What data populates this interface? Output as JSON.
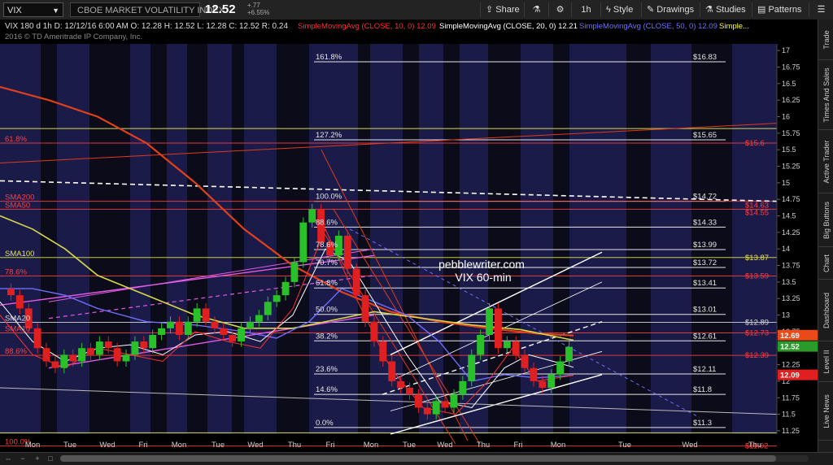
{
  "header": {
    "symbol": "VIX",
    "name": "CBOE MARKET VOLATILITY INDEX",
    "last": "12.52",
    "change": "+.77",
    "change_pct": "+6.55%",
    "share": "Share",
    "timeframe": "1h",
    "style": "Style",
    "drawings": "Drawings",
    "studies": "Studies",
    "patterns": "Patterns"
  },
  "sidebar": {
    "tabs": [
      "Trade",
      "Times And Sales",
      "Active Trader",
      "Big Buttons",
      "Chart",
      "Dashboard",
      "Level II",
      "Live News"
    ]
  },
  "chart_data": {
    "type": "candlestick",
    "ohlc_line": "VIX 180 d 1h  D: 12/12/16 6:00 AM  O: 12.28  H: 12.52  L: 12.28  C: 12.52  R: 0.24",
    "studies": [
      {
        "label": "SimpleMovingAvg (CLOSE, 10, 0)",
        "value": "12.09",
        "color": "#ff3030"
      },
      {
        "label": "SimpleMovingAvg (CLOSE, 20, 0)",
        "value": "12.21",
        "color": "#ffffff"
      },
      {
        "label": "SimpleMovingAvg (CLOSE, 50, 0)",
        "value": "12.09",
        "color": "#6f6fff"
      },
      {
        "label": "Simple...",
        "value": "",
        "color": "#ffff00"
      }
    ],
    "copyright": "2016 © TD Ameritrade IP Company, Inc.",
    "watermark": [
      "pebblewriter.com",
      "VIX 60-min"
    ],
    "ylim": [
      11.2,
      17.1
    ],
    "y_ticks": [
      "17",
      "16.75",
      "16.5",
      "16.25",
      "16",
      "15.75",
      "15.5",
      "15.25",
      "15",
      "14.75",
      "14.5",
      "14.25",
      "14",
      "13.75",
      "13.5",
      "13.25",
      "13",
      "12.75",
      "12.5",
      "12.25",
      "12",
      "11.75",
      "11.5",
      "11.25"
    ],
    "x_ticks": [
      "Mon",
      "Tue",
      "Wed",
      "Fri",
      "Mon",
      "Tue",
      "Wed",
      "Thu",
      "Fri",
      "Mon",
      "Tue",
      "Wed",
      "Thu",
      "Fri",
      "Mon",
      "Tue",
      "Wed",
      "Thu"
    ],
    "fib_levels": [
      {
        "label": "161.8%",
        "value": "$16.83",
        "y": 16.83
      },
      {
        "label": "127.2%",
        "value": "$15.65",
        "y": 15.65
      },
      {
        "label": "100.0%",
        "value": "$14.72",
        "y": 14.72
      },
      {
        "label": "88.6%",
        "value": "$14.33",
        "y": 14.33
      },
      {
        "label": "78.6%",
        "value": "$13.99",
        "y": 13.99
      },
      {
        "label": "70.7%",
        "value": "$13.72",
        "y": 13.72
      },
      {
        "label": "61.8%",
        "value": "$13.41",
        "y": 13.41
      },
      {
        "label": "50.0%",
        "value": "$13.01",
        "y": 13.01
      },
      {
        "label": "38.2%",
        "value": "$12.61",
        "y": 12.61
      },
      {
        "label": "23.6%",
        "value": "$12.11",
        "y": 12.11
      },
      {
        "label": "14.6%",
        "value": "$11.8",
        "y": 11.8
      },
      {
        "label": "0.0%",
        "value": "$11.3",
        "y": 11.3
      }
    ],
    "left_labels": [
      {
        "text": "61.8%",
        "y": 15.6,
        "color": "#ff4040"
      },
      {
        "text": "SMA200",
        "y": 14.72,
        "color": "#ff4040"
      },
      {
        "text": "SMA50",
        "y": 14.6,
        "color": "#ff4040"
      },
      {
        "text": "SMA100",
        "y": 13.87,
        "color": "#e8e84a"
      },
      {
        "text": "78.6%",
        "y": 13.59,
        "color": "#ff4040"
      },
      {
        "text": "SMA20",
        "y": 12.89,
        "color": "#dddddd"
      },
      {
        "text": "SMA10",
        "y": 12.73,
        "color": "#ff4040"
      },
      {
        "text": "88.6%",
        "y": 12.39,
        "color": "#ff4040"
      },
      {
        "text": "100.0%",
        "y": 11.02,
        "color": "#ff4040"
      }
    ],
    "right_labels": [
      {
        "text": "$15.6",
        "y": 15.6,
        "color": "#ff4040"
      },
      {
        "text": "$14.63",
        "y": 14.66,
        "color": "#ff4040"
      },
      {
        "text": "$14.55",
        "y": 14.55,
        "color": "#ff4040"
      },
      {
        "text": "$13.87",
        "y": 13.87,
        "color": "#e8e84a"
      },
      {
        "text": "$13.59",
        "y": 13.59,
        "color": "#ff4040"
      },
      {
        "text": "$12.89",
        "y": 12.89,
        "color": "#dddddd"
      },
      {
        "text": "$12.73",
        "y": 12.73,
        "color": "#ff4040"
      },
      {
        "text": "$12.39",
        "y": 12.39,
        "color": "#ff4040"
      },
      {
        "text": "$11.02",
        "y": 11.02,
        "color": "#ff4040"
      }
    ],
    "price_tags": [
      {
        "text": "12.69",
        "y": 12.69,
        "color": "#e84a1a"
      },
      {
        "text": "12.52",
        "y": 12.52,
        "color": "#2a9a2a"
      },
      {
        "text": "12.09",
        "y": 12.09,
        "color": "#e02020"
      }
    ]
  }
}
